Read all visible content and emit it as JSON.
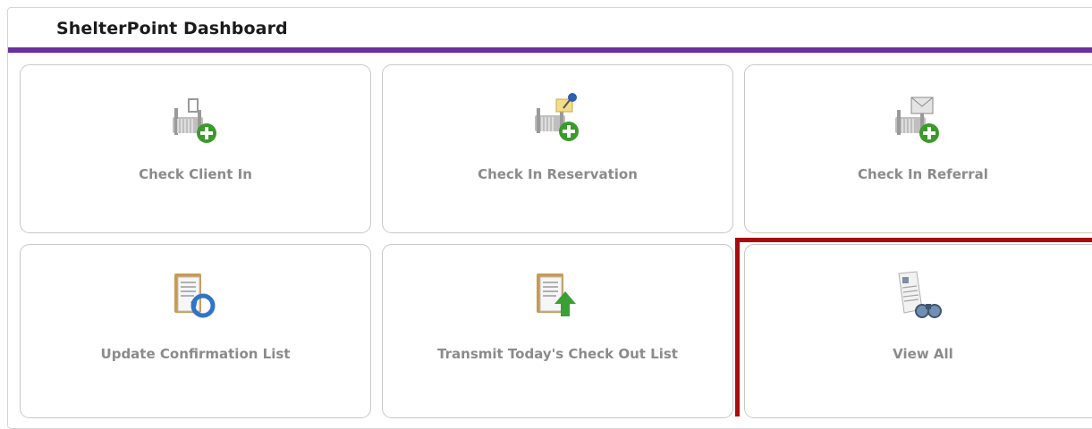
{
  "dashboard": {
    "title": "ShelterPoint Dashboard",
    "accent_color": "#6b2fa0",
    "highlight_color": "#a80d0d"
  },
  "tiles": [
    {
      "label": "Check Client In",
      "icon": "bed-plus-icon"
    },
    {
      "label": "Check In Reservation",
      "icon": "bed-pin-plus-icon"
    },
    {
      "label": "Check In Referral",
      "icon": "bed-envelope-plus-icon"
    },
    {
      "label": "Update Confirmation List",
      "icon": "clipboard-refresh-icon"
    },
    {
      "label": "Transmit Today's Check Out List",
      "icon": "clipboard-upload-icon"
    },
    {
      "label": "View All",
      "icon": "document-binoculars-icon"
    }
  ]
}
